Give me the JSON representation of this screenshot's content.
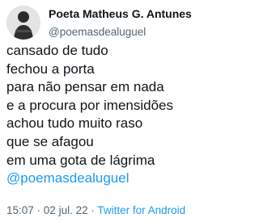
{
  "author": {
    "display_name": "Poeta Matheus G. Antunes",
    "handle": "@poemasdealuguel",
    "avatar_icon": "profile-photo"
  },
  "tweet": {
    "lines": [
      "cansado de tudo",
      "fechou a porta",
      "para não pensar em nada",
      "e a procura por imensidões",
      "achou tudo muito raso",
      "que se afagou",
      "em uma gota de lágrima"
    ],
    "mention": "@poemasdealuguel"
  },
  "meta": {
    "time": "15:07",
    "separator1": " · ",
    "date": "02 jul. 22",
    "separator2": " · ",
    "source": "Twitter for Android"
  },
  "colors": {
    "text": "#0f1419",
    "secondary": "#536471",
    "link": "#1d9bf0",
    "background": "#ffffff"
  }
}
